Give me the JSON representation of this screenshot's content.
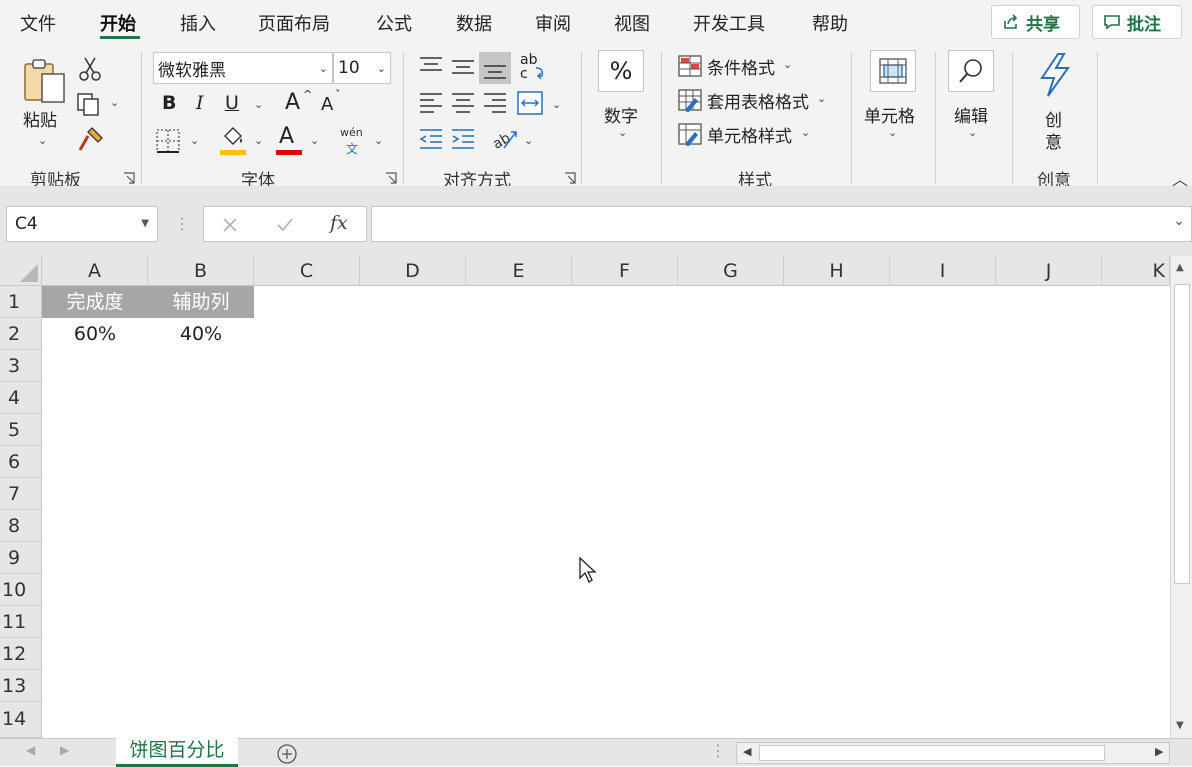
{
  "menu": {
    "tabs": [
      "文件",
      "开始",
      "插入",
      "页面布局",
      "公式",
      "数据",
      "审阅",
      "视图",
      "开发工具",
      "帮助"
    ],
    "active_tab": "开始",
    "share_label": "共享",
    "comment_label": "批注"
  },
  "ribbon": {
    "clipboard": {
      "paste_label": "粘贴",
      "group_label": "剪贴板"
    },
    "font": {
      "font_name": "微软雅黑",
      "font_size": "10",
      "bold": "B",
      "italic": "I",
      "underline": "U",
      "grow": "A",
      "shrink": "A",
      "font_color": "A",
      "phonetic_top": "wén",
      "phonetic_bottom": "文",
      "group_label": "字体"
    },
    "alignment": {
      "wrap_top": "ab",
      "wrap_bottom": "c",
      "group_label": "对齐方式"
    },
    "number": {
      "symbol": "%",
      "label": "数字"
    },
    "styles": {
      "conditional": "条件格式",
      "table_format": "套用表格格式",
      "cell_styles": "单元格样式",
      "group_label": "样式"
    },
    "cells": {
      "label": "单元格"
    },
    "editing": {
      "label": "编辑"
    },
    "ideas": {
      "label_top": "创",
      "label_bottom": "意",
      "group_label": "创意"
    }
  },
  "formula_bar": {
    "name_box": "C4",
    "fx": "fx",
    "formula": ""
  },
  "grid": {
    "columns": [
      "A",
      "B",
      "C",
      "D",
      "E",
      "F",
      "G",
      "H",
      "I",
      "J",
      "K"
    ],
    "rows": [
      "1",
      "2",
      "3",
      "4",
      "5",
      "6",
      "7",
      "8",
      "9",
      "10",
      "11",
      "12",
      "13",
      "14"
    ],
    "cells": {
      "A1": "完成度",
      "B1": "辅助列",
      "A2": "60%",
      "B2": "40%"
    }
  },
  "sheets": {
    "active": "饼图百分比"
  },
  "colors": {
    "accent": "#217346",
    "header_fill": "#a6a6a6",
    "font_color_bar": "#e0000f",
    "fill_color_bar": "#ffc000"
  }
}
